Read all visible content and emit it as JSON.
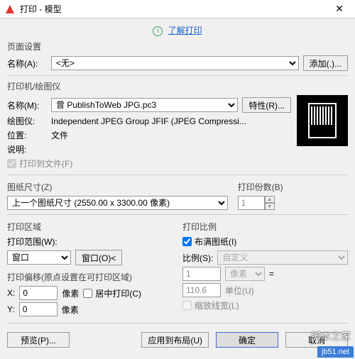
{
  "window": {
    "title": "打印 - 模型"
  },
  "helpLink": "了解打印",
  "pageSetup": {
    "title": "页面设置",
    "nameLabel": "名称(A):",
    "nameValue": "<无>",
    "addBtn": "添加(.)..."
  },
  "printer": {
    "title": "打印机/绘图仪",
    "nameLabel": "名称(M):",
    "nameValue": "曾 PublishToWeb JPG.pc3",
    "propsBtn": "特性(R)...",
    "plotterLabel": "绘图仪:",
    "plotterValue": "Independent JPEG Group JFIF (JPEG Compressi...",
    "whereLabel": "位置:",
    "whereValue": "文件",
    "descLabel": "说明:",
    "toFileLabel": "打印到文件(F)"
  },
  "paper": {
    "title": "图纸尺寸(Z)",
    "value": "上一个图纸尺寸 (2550.00 x 3300.00 像素)"
  },
  "copies": {
    "title": "打印份数(B)",
    "value": "1"
  },
  "area": {
    "title": "打印区域",
    "rangeLabel": "打印范围(W):",
    "rangeValue": "窗口",
    "windowBtn": "窗口(O)<"
  },
  "offset": {
    "title": "打印偏移(原点设置在可打印区域)",
    "xLabel": "X:",
    "xValue": "0",
    "xUnit": "像素",
    "centerLabel": "居中打印(C)",
    "yLabel": "Y:",
    "yValue": "0",
    "yUnit": "像素"
  },
  "scale": {
    "title": "打印比例",
    "fitLabel": "布满图纸(I)",
    "ratioLabel": "比例(S):",
    "ratioValue": "自定义",
    "num": "1",
    "numUnit": "像素",
    "eq": "=",
    "den": "110.6",
    "denUnit": "单位(U)",
    "lwLabel": "缩放线宽(L)"
  },
  "buttons": {
    "preview": "预览(P)...",
    "apply": "应用到布局(U)",
    "ok": "确定",
    "cancel": "取消"
  },
  "brand": "脚本之家",
  "wm": "jb51.net"
}
